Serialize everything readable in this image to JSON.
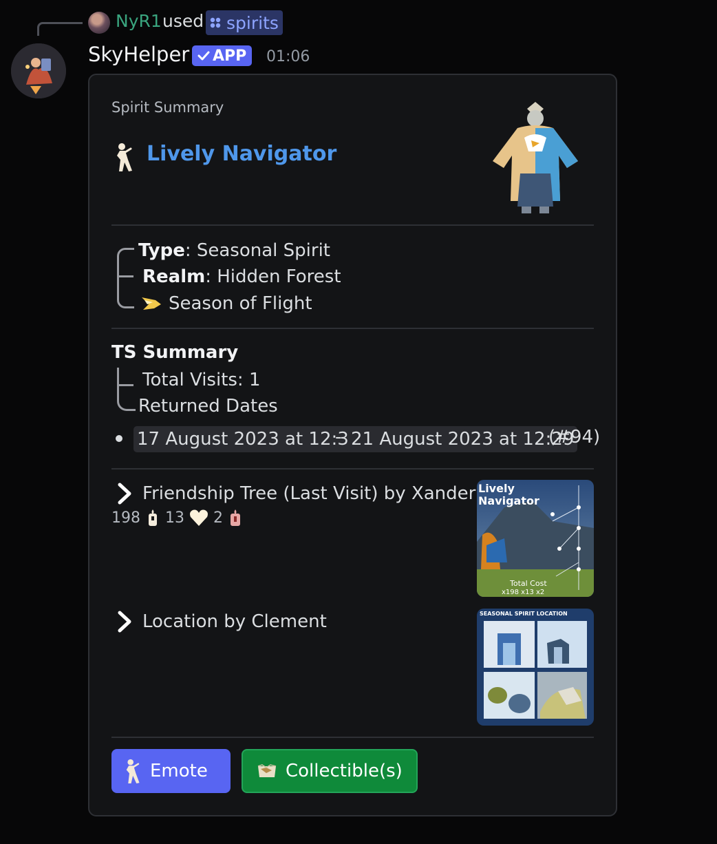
{
  "reply": {
    "username": "NyR1",
    "used_text": "used",
    "command": "spirits"
  },
  "message": {
    "bot_name": "SkyHelper",
    "app_badge": "APP",
    "timestamp": "01:06"
  },
  "embed": {
    "author": "Spirit Summary",
    "title": "Lively Navigator",
    "info": {
      "type_label": "Type",
      "type_value": ": Seasonal Spirit",
      "realm_label": "Realm",
      "realm_value": ": Hidden Forest",
      "season": "Season of Flight"
    },
    "ts_summary": {
      "title": "TS Summary",
      "total_visits": "Total Visits: 1",
      "returned_dates": "Returned Dates",
      "date_start": "17 August 2023 at 12:30",
      "dash": "-",
      "date_end": "21 August 2023 at 12:29",
      "visit_number": "(#94)"
    },
    "friendship_tree": {
      "title": "Friendship Tree (Last Visit) by Xander",
      "candles": "198",
      "hearts": "13",
      "ascended": "2",
      "image_text": {
        "title_line1": "Lively",
        "title_line2": "Navigator",
        "total_cost": "Total Cost",
        "cost_line": "x198  x13  x2"
      }
    },
    "location": {
      "title": "Location by Clement",
      "image_text": {
        "header": "SEASONAL SPIRIT LOCATION"
      }
    },
    "buttons": {
      "emote": "Emote",
      "collectibles": "Collectible(s)"
    }
  },
  "colors": {
    "background": "#070708",
    "card": "#131416",
    "title_link": "#4f97ea",
    "button_primary": "#5865f2",
    "button_success": "#0f8a3a",
    "username": "#3aa57f"
  }
}
